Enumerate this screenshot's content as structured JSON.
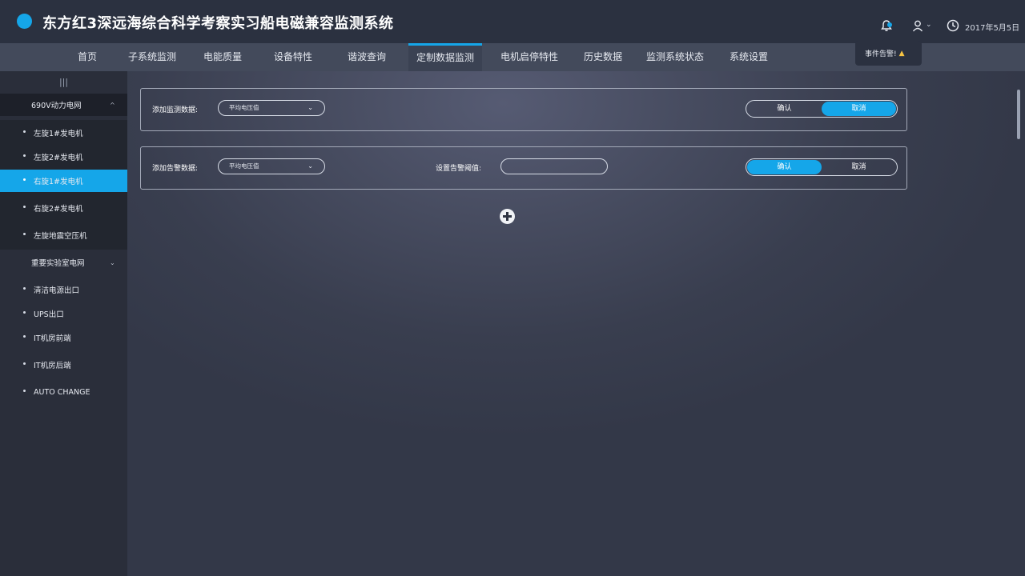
{
  "header": {
    "title": "东方红3深远海综合科学考察实习船电磁兼容监测系统",
    "date": "2017年5月5日",
    "icons": {
      "bell": "bell-icon",
      "user": "user-icon",
      "clock": "clock-icon"
    },
    "user_chevron": "⌄"
  },
  "tooltip": {
    "text": "事件告警!",
    "icon": "warning-icon"
  },
  "nav": {
    "items": [
      {
        "label": "首页"
      },
      {
        "label": "子系统监测"
      },
      {
        "label": "电能质量"
      },
      {
        "label": "设备特性"
      },
      {
        "label": "谐波查询"
      },
      {
        "label": "定制数据监测"
      },
      {
        "label": "电机启停特性"
      },
      {
        "label": "历史数据"
      },
      {
        "label": "监测系统状态"
      },
      {
        "label": "系统设置"
      }
    ],
    "active": "定制数据监测"
  },
  "sidebar": {
    "collapse_icon": "|||",
    "groups": [
      {
        "label": "690V动力电网",
        "chevron": "^",
        "items": [
          {
            "label": "左旋1#发电机"
          },
          {
            "label": "左旋2#发电机"
          },
          {
            "label": "右旋1#发电机"
          },
          {
            "label": "右旋2#发电机"
          },
          {
            "label": "左旋地震空压机"
          }
        ]
      },
      {
        "label": "重要实验室电网",
        "chevron": "⌄",
        "items": [
          {
            "label": "清洁电源出口"
          },
          {
            "label": "UPS出口"
          },
          {
            "label": "IT机房前端"
          },
          {
            "label": "IT机房后端"
          },
          {
            "label": "AUTO CHANGE"
          }
        ]
      }
    ],
    "active_item": "右旋1#发电机"
  },
  "panels": {
    "monitor": {
      "label": "添加监测数据:",
      "select_value": "平均电压值",
      "caret": "⌄",
      "confirm": "确认",
      "cancel": "取消",
      "selected": "cancel"
    },
    "alarm": {
      "label": "添加告警数据:",
      "select_value": "平均电压值",
      "caret": "⌄",
      "threshold_label": "设置告警阈值:",
      "threshold_value": "",
      "confirm": "确认",
      "cancel": "取消",
      "selected": "confirm"
    }
  },
  "colors": {
    "accent": "#15a6e9",
    "header_bg": "#2b3140",
    "nav_bg": "#434a5b",
    "sidebar_bg": "#2a2e3a"
  }
}
